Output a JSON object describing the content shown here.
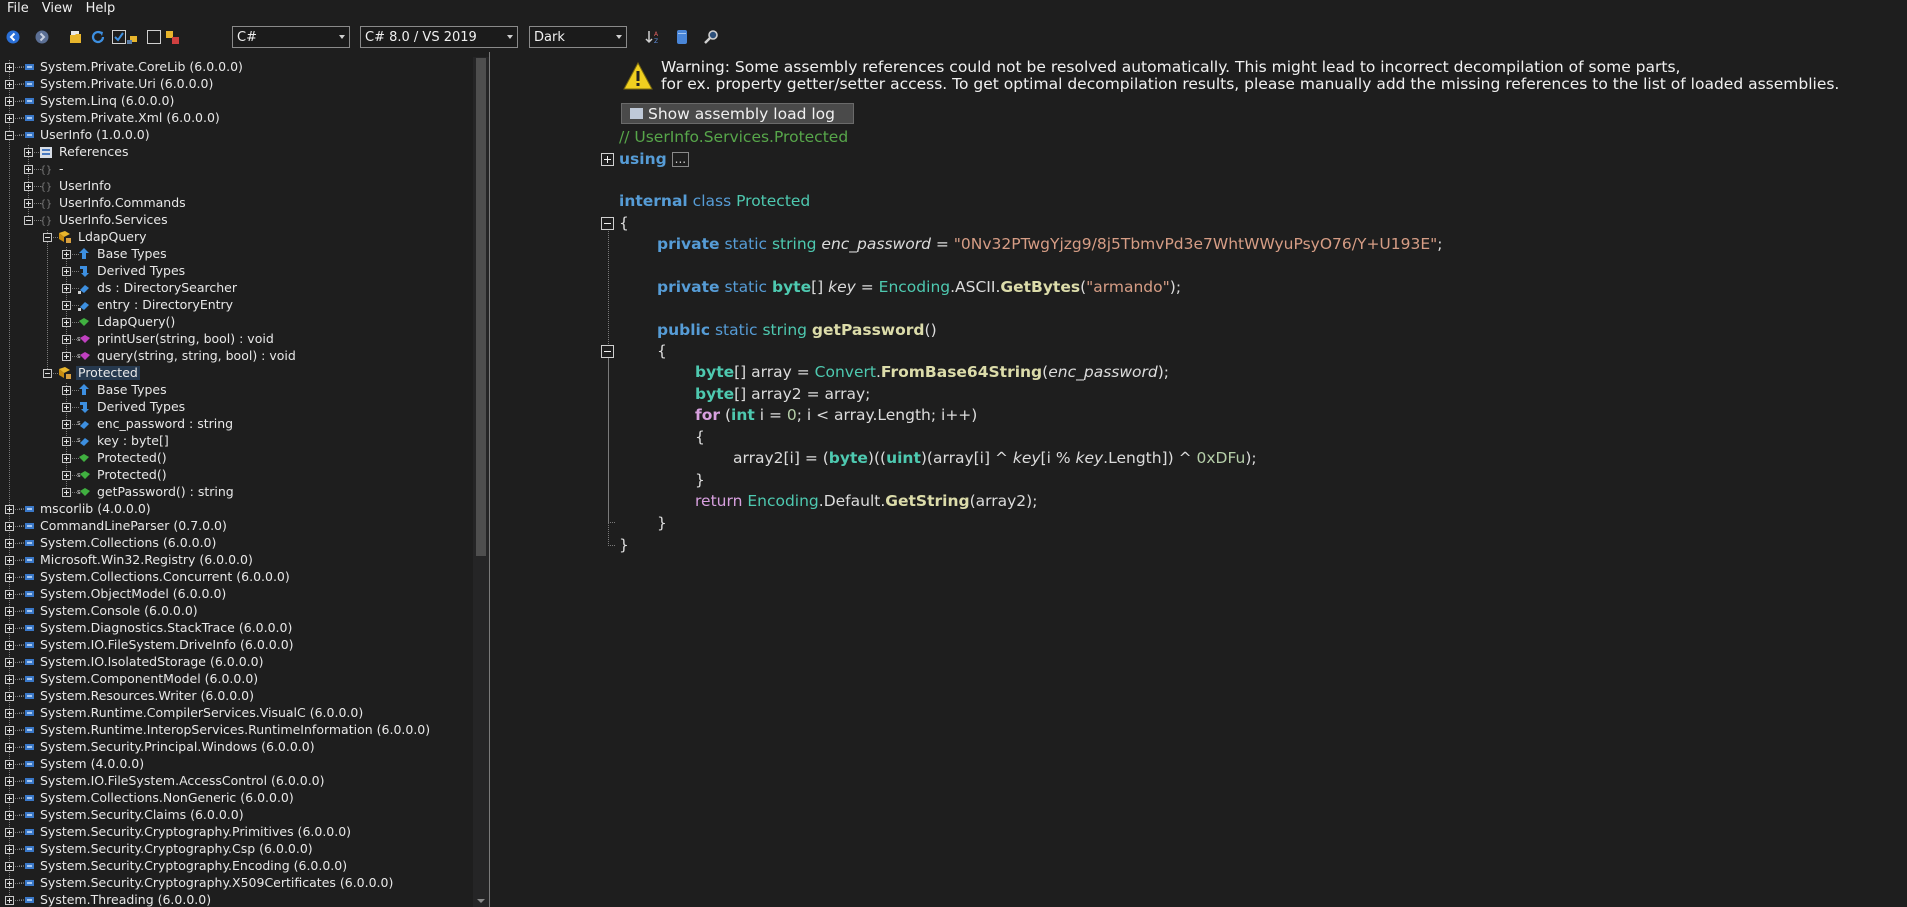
{
  "menu": [
    "File",
    "View",
    "Help"
  ],
  "toolbar": {
    "language": "C#",
    "language_version": "C# 8.0 / VS 2019",
    "theme": "Dark"
  },
  "tree": [
    {
      "label": "System.Private.CoreLib (6.0.0.0)",
      "depth": 0,
      "expander": "plus",
      "icon": "assembly-icon"
    },
    {
      "label": "System.Private.Uri (6.0.0.0)",
      "depth": 0,
      "expander": "plus",
      "icon": "assembly-icon"
    },
    {
      "label": "System.Linq (6.0.0.0)",
      "depth": 0,
      "expander": "plus",
      "icon": "assembly-icon"
    },
    {
      "label": "System.Private.Xml (6.0.0.0)",
      "depth": 0,
      "expander": "plus",
      "icon": "assembly-icon"
    },
    {
      "label": "UserInfo (1.0.0.0)",
      "depth": 0,
      "expander": "minus",
      "icon": "assembly-icon"
    },
    {
      "label": "References",
      "depth": 1,
      "expander": "plus",
      "icon": "references-icon"
    },
    {
      "label": "-",
      "depth": 1,
      "expander": "plus",
      "icon": "namespace-icon"
    },
    {
      "label": "UserInfo",
      "depth": 1,
      "expander": "plus",
      "icon": "namespace-icon"
    },
    {
      "label": "UserInfo.Commands",
      "depth": 1,
      "expander": "plus",
      "icon": "namespace-icon"
    },
    {
      "label": "UserInfo.Services",
      "depth": 1,
      "expander": "minus",
      "icon": "namespace-icon"
    },
    {
      "label": "LdapQuery",
      "depth": 2,
      "expander": "minus",
      "icon": "class-icon"
    },
    {
      "label": "Base Types",
      "depth": 3,
      "expander": "plus",
      "icon": "base-types-icon"
    },
    {
      "label": "Derived Types",
      "depth": 3,
      "expander": "plus",
      "icon": "derived-types-icon"
    },
    {
      "label": "ds : DirectorySearcher",
      "depth": 3,
      "expander": "plus",
      "icon": "field-icon"
    },
    {
      "label": "entry : DirectoryEntry",
      "depth": 3,
      "expander": "plus",
      "icon": "field-icon"
    },
    {
      "label": "LdapQuery()",
      "depth": 3,
      "expander": "plus",
      "icon": "method-icon"
    },
    {
      "label": "printUser(string, bool) : void",
      "depth": 3,
      "expander": "plus",
      "icon": "private-method-icon"
    },
    {
      "label": "query(string, string, bool) : void",
      "depth": 3,
      "expander": "plus",
      "icon": "private-method-icon"
    },
    {
      "label": "Protected",
      "depth": 2,
      "expander": "minus",
      "icon": "class-icon",
      "selected": true
    },
    {
      "label": "Base Types",
      "depth": 3,
      "expander": "plus",
      "icon": "base-types-icon"
    },
    {
      "label": "Derived Types",
      "depth": 3,
      "expander": "plus",
      "icon": "derived-types-icon"
    },
    {
      "label": "enc_password : string",
      "depth": 3,
      "expander": "plus",
      "icon": "static-field-icon"
    },
    {
      "label": "key : byte[]",
      "depth": 3,
      "expander": "plus",
      "icon": "static-field-icon"
    },
    {
      "label": "Protected()",
      "depth": 3,
      "expander": "plus",
      "icon": "method-icon"
    },
    {
      "label": "Protected()",
      "depth": 3,
      "expander": "plus",
      "icon": "static-method-icon"
    },
    {
      "label": "getPassword() : string",
      "depth": 3,
      "expander": "plus",
      "icon": "static-method-icon"
    },
    {
      "label": "mscorlib (4.0.0.0)",
      "depth": 0,
      "expander": "plus",
      "icon": "assembly-icon"
    },
    {
      "label": "CommandLineParser (0.7.0.0)",
      "depth": 0,
      "expander": "plus",
      "icon": "assembly-icon"
    },
    {
      "label": "System.Collections (6.0.0.0)",
      "depth": 0,
      "expander": "plus",
      "icon": "assembly-icon"
    },
    {
      "label": "Microsoft.Win32.Registry (6.0.0.0)",
      "depth": 0,
      "expander": "plus",
      "icon": "assembly-icon"
    },
    {
      "label": "System.Collections.Concurrent (6.0.0.0)",
      "depth": 0,
      "expander": "plus",
      "icon": "assembly-icon"
    },
    {
      "label": "System.ObjectModel (6.0.0.0)",
      "depth": 0,
      "expander": "plus",
      "icon": "assembly-icon"
    },
    {
      "label": "System.Console (6.0.0.0)",
      "depth": 0,
      "expander": "plus",
      "icon": "assembly-icon"
    },
    {
      "label": "System.Diagnostics.StackTrace (6.0.0.0)",
      "depth": 0,
      "expander": "plus",
      "icon": "assembly-icon"
    },
    {
      "label": "System.IO.FileSystem.DriveInfo (6.0.0.0)",
      "depth": 0,
      "expander": "plus",
      "icon": "assembly-icon"
    },
    {
      "label": "System.IO.IsolatedStorage (6.0.0.0)",
      "depth": 0,
      "expander": "plus",
      "icon": "assembly-icon"
    },
    {
      "label": "System.ComponentModel (6.0.0.0)",
      "depth": 0,
      "expander": "plus",
      "icon": "assembly-icon"
    },
    {
      "label": "System.Resources.Writer (6.0.0.0)",
      "depth": 0,
      "expander": "plus",
      "icon": "assembly-icon"
    },
    {
      "label": "System.Runtime.CompilerServices.VisualC (6.0.0.0)",
      "depth": 0,
      "expander": "plus",
      "icon": "assembly-icon"
    },
    {
      "label": "System.Runtime.InteropServices.RuntimeInformation (6.0.0.0)",
      "depth": 0,
      "expander": "plus",
      "icon": "assembly-icon"
    },
    {
      "label": "System.Security.Principal.Windows (6.0.0.0)",
      "depth": 0,
      "expander": "plus",
      "icon": "assembly-icon"
    },
    {
      "label": "System (4.0.0.0)",
      "depth": 0,
      "expander": "plus",
      "icon": "assembly-icon"
    },
    {
      "label": "System.IO.FileSystem.AccessControl (6.0.0.0)",
      "depth": 0,
      "expander": "plus",
      "icon": "assembly-icon"
    },
    {
      "label": "System.Collections.NonGeneric (6.0.0.0)",
      "depth": 0,
      "expander": "plus",
      "icon": "assembly-icon"
    },
    {
      "label": "System.Security.Claims (6.0.0.0)",
      "depth": 0,
      "expander": "plus",
      "icon": "assembly-icon"
    },
    {
      "label": "System.Security.Cryptography.Primitives (6.0.0.0)",
      "depth": 0,
      "expander": "plus",
      "icon": "assembly-icon"
    },
    {
      "label": "System.Security.Cryptography.Csp (6.0.0.0)",
      "depth": 0,
      "expander": "plus",
      "icon": "assembly-icon"
    },
    {
      "label": "System.Security.Cryptography.Encoding (6.0.0.0)",
      "depth": 0,
      "expander": "plus",
      "icon": "assembly-icon"
    },
    {
      "label": "System.Security.Cryptography.X509Certificates (6.0.0.0)",
      "depth": 0,
      "expander": "plus",
      "icon": "assembly-icon"
    },
    {
      "label": "System.Threading (6.0.0.0)",
      "depth": 0,
      "expander": "plus",
      "icon": "assembly-icon"
    }
  ],
  "code_view": {
    "warning_line1": "Warning: Some assembly references could not be resolved automatically. This might lead to incorrect decompilation of some parts,",
    "warning_line2": "for ex. property getter/setter access. To get optimal decompilation results, please manually add the missing references to the list of loaded assemblies.",
    "show_log_button": "Show assembly load log",
    "namespace_comment": "// UserInfo.Services.Protected",
    "using_keyword": "using",
    "using_collapsed": "...",
    "enc_password_value": "\"0Nv32PTwgYjzg9/8j5TbmvPd3e7WhtWWyuPsyO76/Y+U193E\"",
    "key_value": "\"armando\"",
    "xor_constant": "0xDFu"
  },
  "colors": {
    "background": "#1e1e1e",
    "keyword": "#569cd6",
    "type": "#4ec9b0",
    "string": "#d69d85",
    "comment": "#57a64a",
    "method": "#dcdcaa",
    "control_keyword": "#d8a0df",
    "selection": "#26394f"
  }
}
